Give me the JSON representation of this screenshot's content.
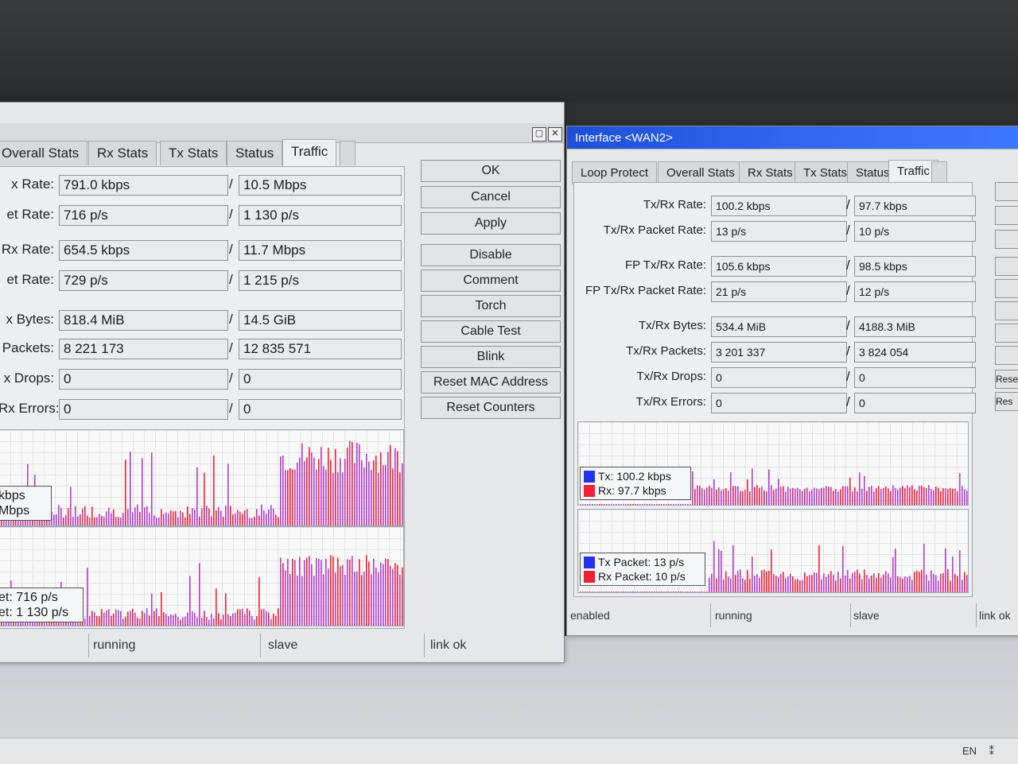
{
  "win1": {
    "tabs": [
      "Overall Stats",
      "Rx Stats",
      "Tx Stats",
      "Status",
      "Traffic",
      "..."
    ],
    "rows": [
      {
        "label": "x Rate:",
        "a": "791.0 kbps",
        "b": "10.5 Mbps"
      },
      {
        "label": "et Rate:",
        "a": "716 p/s",
        "b": "1 130 p/s"
      },
      {
        "label": "Rx Rate:",
        "a": "654.5 kbps",
        "b": "11.7 Mbps"
      },
      {
        "label": "et Rate:",
        "a": "729 p/s",
        "b": "1 215 p/s"
      },
      {
        "label": "x Bytes:",
        "a": "818.4 MiB",
        "b": "14.5 GiB"
      },
      {
        "label": "Packets:",
        "a": "8 221 173",
        "b": "12 835 571"
      },
      {
        "label": "x Drops:",
        "a": "0",
        "b": "0"
      },
      {
        "label": "Rx Errors:",
        "a": "0",
        "b": "0"
      }
    ],
    "graph1_legend": [
      "kbps",
      "Mbps"
    ],
    "graph2_legend": [
      "et: 716 p/s",
      "et: 1 130 p/s"
    ],
    "buttons": [
      "OK",
      "Cancel",
      "Apply",
      "Disable",
      "Comment",
      "Torch",
      "Cable Test",
      "Blink",
      "Reset MAC Address",
      "Reset Counters"
    ],
    "status": [
      "running",
      "slave",
      "link ok"
    ]
  },
  "win2": {
    "title": "Interface <WAN2>",
    "tabs": [
      "Loop Protect",
      "Overall Stats",
      "Rx Stats",
      "Tx Stats",
      "Status",
      "Traffic",
      "..."
    ],
    "rows": [
      {
        "label": "Tx/Rx Rate:",
        "a": "100.2 kbps",
        "b": "97.7 kbps"
      },
      {
        "label": "Tx/Rx Packet Rate:",
        "a": "13 p/s",
        "b": "10 p/s"
      },
      {
        "label": "FP Tx/Rx Rate:",
        "a": "105.6 kbps",
        "b": "98.5 kbps"
      },
      {
        "label": "FP Tx/Rx Packet Rate:",
        "a": "21 p/s",
        "b": "12 p/s"
      },
      {
        "label": "Tx/Rx Bytes:",
        "a": "534.4 MiB",
        "b": "4188.3 MiB"
      },
      {
        "label": "Tx/Rx Packets:",
        "a": "3 201 337",
        "b": "3 824 054"
      },
      {
        "label": "Tx/Rx Drops:",
        "a": "0",
        "b": "0"
      },
      {
        "label": "Tx/Rx Errors:",
        "a": "0",
        "b": "0"
      }
    ],
    "graph1_legend": [
      "Tx: 100.2 kbps",
      "Rx: 97.7 kbps"
    ],
    "graph2_legend": [
      "Tx Packet: 13 p/s",
      "Rx Packet: 10 p/s"
    ],
    "side_buttons": [
      "Reset",
      "Res"
    ],
    "status": [
      "enabled",
      "running",
      "slave",
      "link ok"
    ]
  },
  "taskbar": {
    "lang": "EN"
  },
  "colors": {
    "tx": "#2233ee",
    "rx": "#ee2233",
    "overlap": "#b040c8"
  }
}
